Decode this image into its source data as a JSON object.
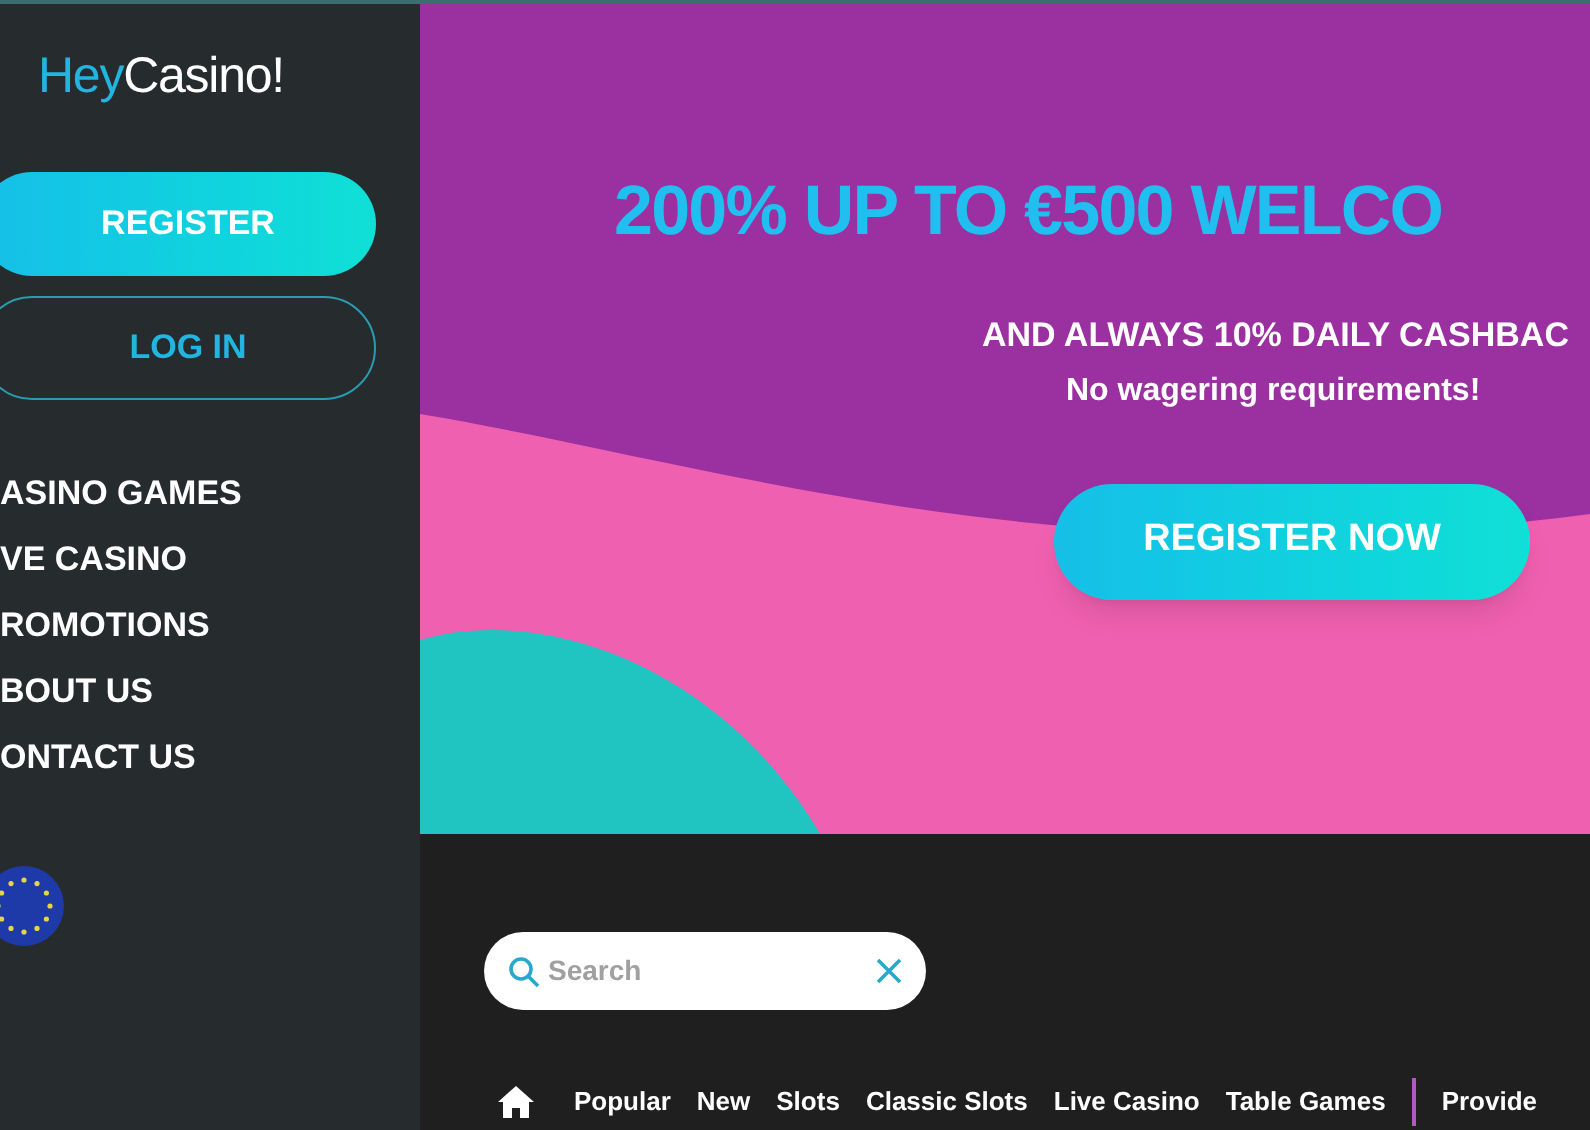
{
  "sidebar": {
    "logo": {
      "part_1": "Hey",
      "part_2": "Casino!"
    },
    "register_button": "REGISTER",
    "login_button": "LOG IN",
    "menu": [
      {
        "label": "ASINO GAMES"
      },
      {
        "label": "VE CASINO"
      },
      {
        "label": "ROMOTIONS"
      },
      {
        "label": "BOUT US"
      },
      {
        "label": "ONTACT US"
      }
    ]
  },
  "hero": {
    "headline": "200% UP TO €500 WELCO",
    "subheadline": "AND ALWAYS 10% DAILY CASHBAC",
    "note": "No wagering requirements!",
    "cta": "REGISTER NOW"
  },
  "search": {
    "placeholder": "Search"
  },
  "categories": [
    {
      "label": "Popular"
    },
    {
      "label": "New"
    },
    {
      "label": "Slots"
    },
    {
      "label": "Classic Slots"
    },
    {
      "label": "Live Casino"
    },
    {
      "label": "Table Games"
    }
  ],
  "extra_category": "Provide"
}
